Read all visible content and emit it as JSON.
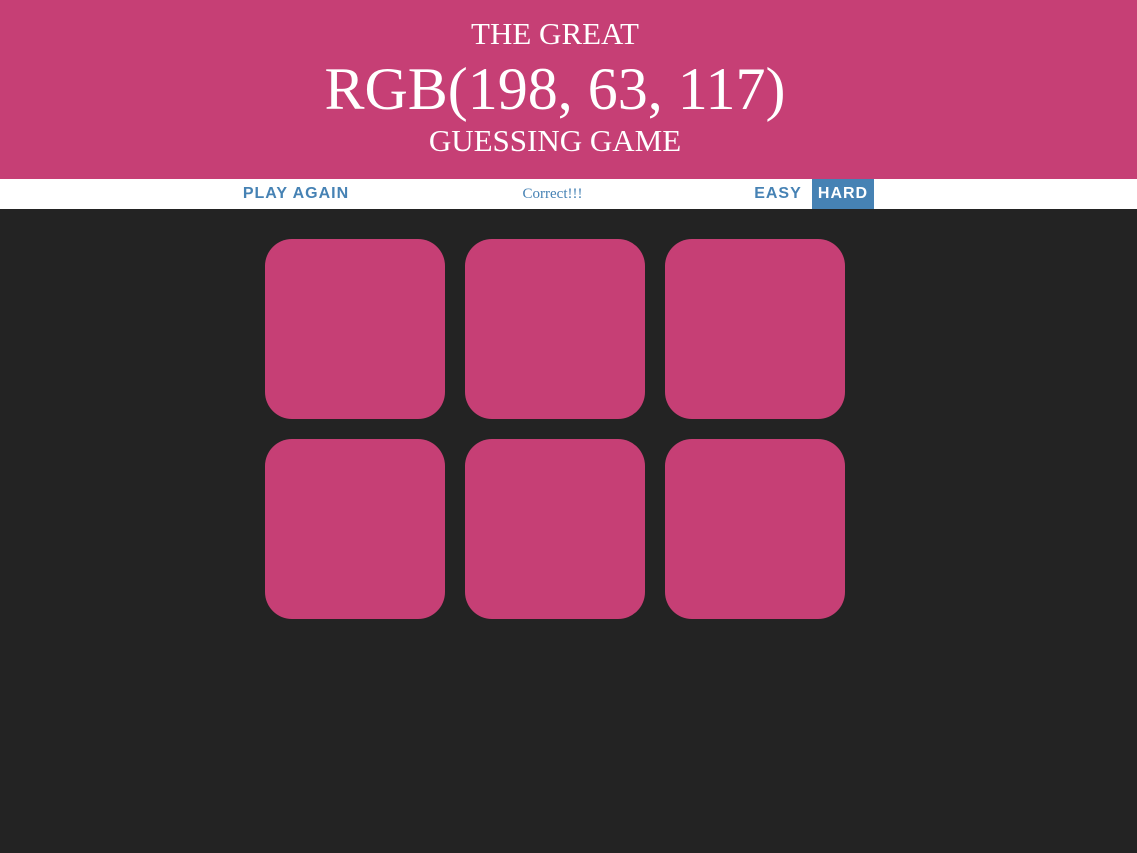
{
  "header": {
    "title_top": "THE GREAT",
    "rgb_display": "RGB(198, 63, 117)",
    "title_bottom": "GUESSING GAME",
    "background_color": "#c63f75"
  },
  "stripe": {
    "reset_label": "PLAY AGAIN",
    "message": "Correct!!!",
    "easy_label": "EASY",
    "hard_label": "HARD",
    "selected_mode": "HARD",
    "accent_color": "#4682b4"
  },
  "game": {
    "background_color": "#232323",
    "squares": [
      {
        "color": "#c63f75"
      },
      {
        "color": "#c63f75"
      },
      {
        "color": "#c63f75"
      },
      {
        "color": "#c63f75"
      },
      {
        "color": "#c63f75"
      },
      {
        "color": "#c63f75"
      }
    ]
  }
}
